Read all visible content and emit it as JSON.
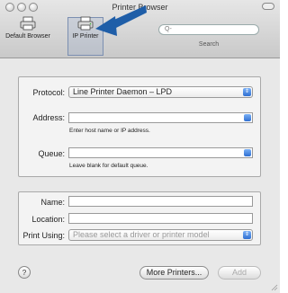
{
  "window": {
    "title": "Printer Browser"
  },
  "toolbar": {
    "default_browser_label": "Default Browser",
    "ip_printer_label": "IP Printer",
    "search_placeholder": "Q-",
    "search_label": "Search"
  },
  "form": {
    "protocol_label": "Protocol:",
    "protocol_value": "Line Printer Daemon – LPD",
    "address_label": "Address:",
    "address_value": "",
    "address_hint": "Enter host name or IP address.",
    "queue_label": "Queue:",
    "queue_value": "",
    "queue_hint": "Leave blank for default queue.",
    "name_label": "Name:",
    "location_label": "Location:",
    "print_using_label": "Print Using:",
    "print_using_value": "Please select a driver or printer model"
  },
  "footer": {
    "help_label": "?",
    "more_printers_label": "More Printers...",
    "add_label": "Add"
  }
}
